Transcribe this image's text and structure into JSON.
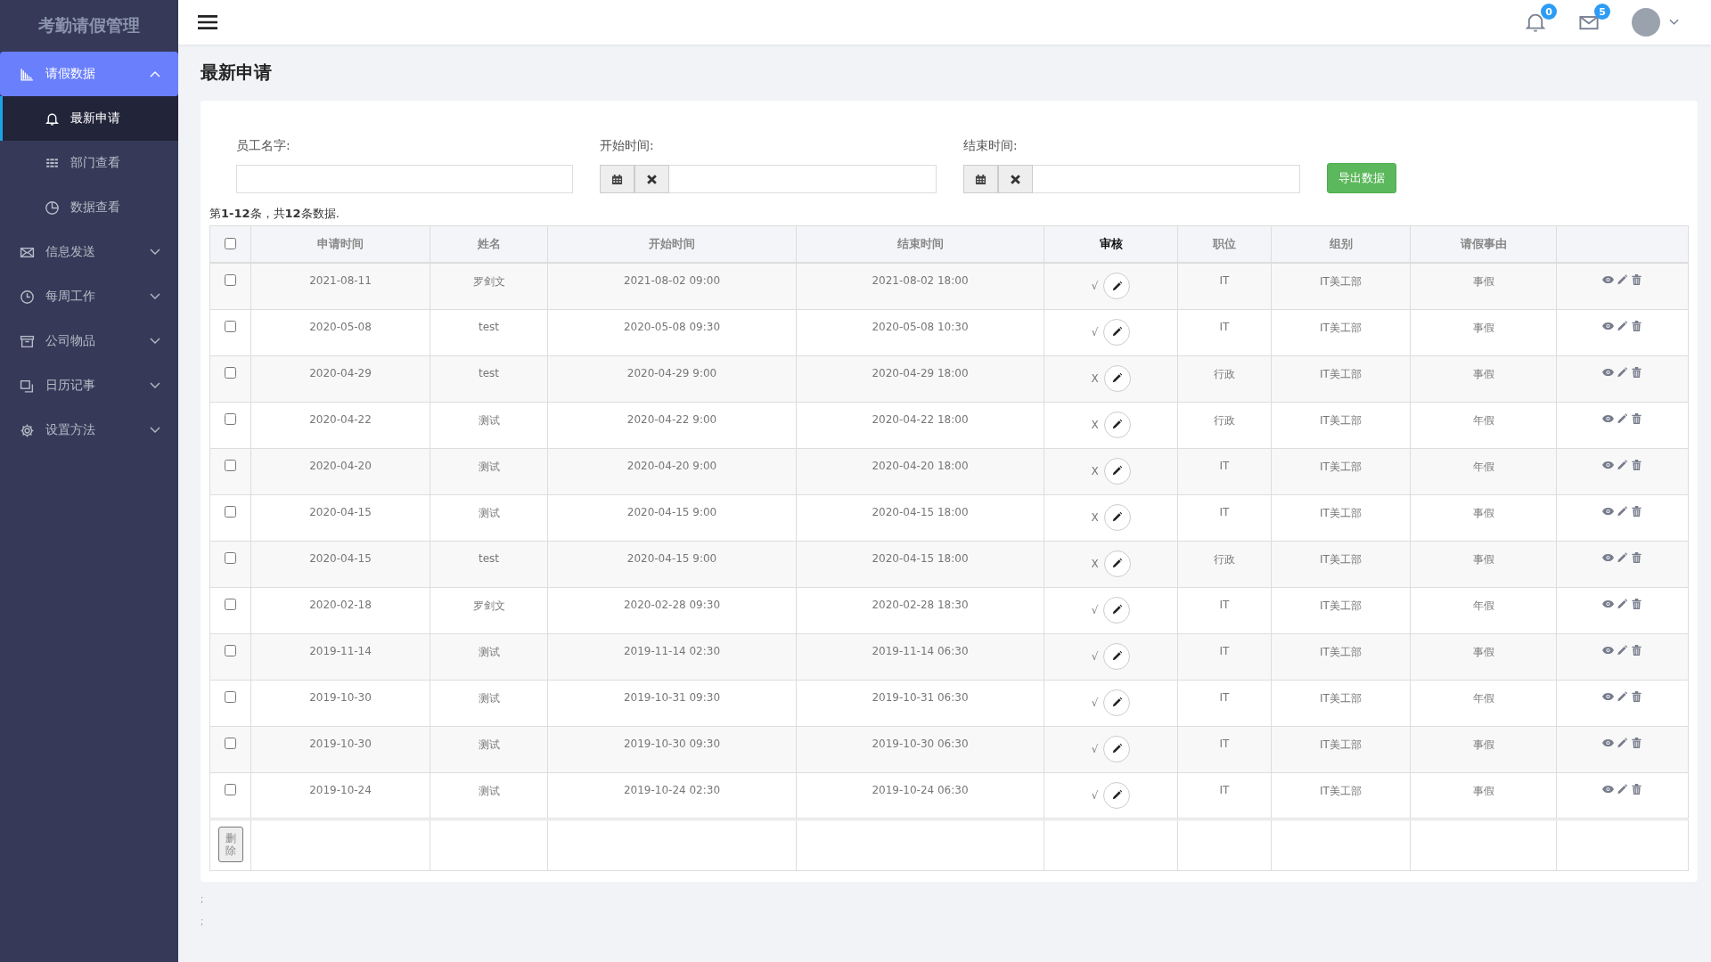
{
  "sidebar": {
    "title": "考勤请假管理",
    "items": [
      {
        "label": "请假数据",
        "expanded": true,
        "selected": true,
        "children": [
          {
            "label": "最新申请",
            "selected": true
          },
          {
            "label": "部门查看",
            "selected": false
          },
          {
            "label": "数据查看",
            "selected": false
          }
        ]
      },
      {
        "label": "信息发送",
        "expanded": false,
        "selected": false
      },
      {
        "label": "每周工作",
        "expanded": false,
        "selected": false
      },
      {
        "label": "公司物品",
        "expanded": false,
        "selected": false
      },
      {
        "label": "日历记事",
        "expanded": false,
        "selected": false
      },
      {
        "label": "设置方法",
        "expanded": false,
        "selected": false
      }
    ]
  },
  "topbar": {
    "notifications": "0",
    "messages": "5"
  },
  "page_title": "最新申请",
  "filters": {
    "employee_label": "员工名字:",
    "start_label": "开始时间:",
    "end_label": "结束时间:",
    "export_button": "导出数据"
  },
  "summary": "第**1-12**条，共**12**条数据.",
  "table": {
    "columns": [
      {
        "label": "申请时间",
        "kind": "plain"
      },
      {
        "label": "姓名",
        "kind": "plain"
      },
      {
        "label": "开始时间",
        "kind": "plain"
      },
      {
        "label": "结束时间",
        "kind": "plain"
      },
      {
        "label": "审核",
        "kind": "link"
      },
      {
        "label": "职位",
        "kind": "plain"
      },
      {
        "label": "组别",
        "kind": "plain"
      },
      {
        "label": "请假事由",
        "kind": "plain"
      }
    ],
    "rows": [
      {
        "checked": false,
        "cells": [
          "2021-08-11",
          "罗剑文",
          "2021-08-02 09:00",
          "2021-08-02 18:00"
        ],
        "audit": "√",
        "position": "IT",
        "group": "IT美工部",
        "reason": "事假"
      },
      {
        "checked": false,
        "cells": [
          "2020-05-08",
          "test",
          "2020-05-08 09:30",
          "2020-05-08 10:30"
        ],
        "audit": "√",
        "position": "IT",
        "group": "IT美工部",
        "reason": "事假"
      },
      {
        "checked": false,
        "cells": [
          "2020-04-29",
          "test",
          "2020-04-29 9:00",
          "2020-04-29 18:00"
        ],
        "audit": "X",
        "position": "行政",
        "group": "IT美工部",
        "reason": "事假"
      },
      {
        "checked": false,
        "cells": [
          "2020-04-22",
          "测试",
          "2020-04-22 9:00",
          "2020-04-22 18:00"
        ],
        "audit": "X",
        "position": "行政",
        "group": "IT美工部",
        "reason": "年假"
      },
      {
        "checked": false,
        "cells": [
          "2020-04-20",
          "测试",
          "2020-04-20 9:00",
          "2020-04-20 18:00"
        ],
        "audit": "X",
        "position": "IT",
        "group": "IT美工部",
        "reason": "年假"
      },
      {
        "checked": false,
        "cells": [
          "2020-04-15",
          "测试",
          "2020-04-15 9:00",
          "2020-04-15 18:00"
        ],
        "audit": "X",
        "position": "IT",
        "group": "IT美工部",
        "reason": "事假"
      },
      {
        "checked": false,
        "cells": [
          "2020-04-15",
          "test",
          "2020-04-15 9:00",
          "2020-04-15 18:00"
        ],
        "audit": "X",
        "position": "行政",
        "group": "IT美工部",
        "reason": "事假"
      },
      {
        "checked": false,
        "cells": [
          "2020-02-18",
          "罗剑文",
          "2020-02-28 09:30",
          "2020-02-28 18:30"
        ],
        "audit": "√",
        "position": "IT",
        "group": "IT美工部",
        "reason": "年假"
      },
      {
        "checked": false,
        "cells": [
          "2019-11-14",
          "测试",
          "2019-11-14 02:30",
          "2019-11-14 06:30"
        ],
        "audit": "√",
        "position": "IT",
        "group": "IT美工部",
        "reason": "事假"
      },
      {
        "checked": false,
        "cells": [
          "2019-10-30",
          "测试",
          "2019-10-31 09:30",
          "2019-10-31 06:30"
        ],
        "audit": "√",
        "position": "IT",
        "group": "IT美工部",
        "reason": "年假"
      },
      {
        "checked": false,
        "cells": [
          "2019-10-30",
          "测试",
          "2019-10-30 09:30",
          "2019-10-30 06:30"
        ],
        "audit": "√",
        "position": "IT",
        "group": "IT美工部",
        "reason": "事假"
      },
      {
        "checked": false,
        "cells": [
          "2019-10-24",
          "测试",
          "2019-10-24 02:30",
          "2019-10-24 06:30"
        ],
        "audit": "√",
        "position": "IT",
        "group": "IT美工部",
        "reason": "事假"
      }
    ],
    "select_all_checked": false,
    "delete_button": "删除"
  },
  "footer_marks": [
    ";",
    ";"
  ]
}
